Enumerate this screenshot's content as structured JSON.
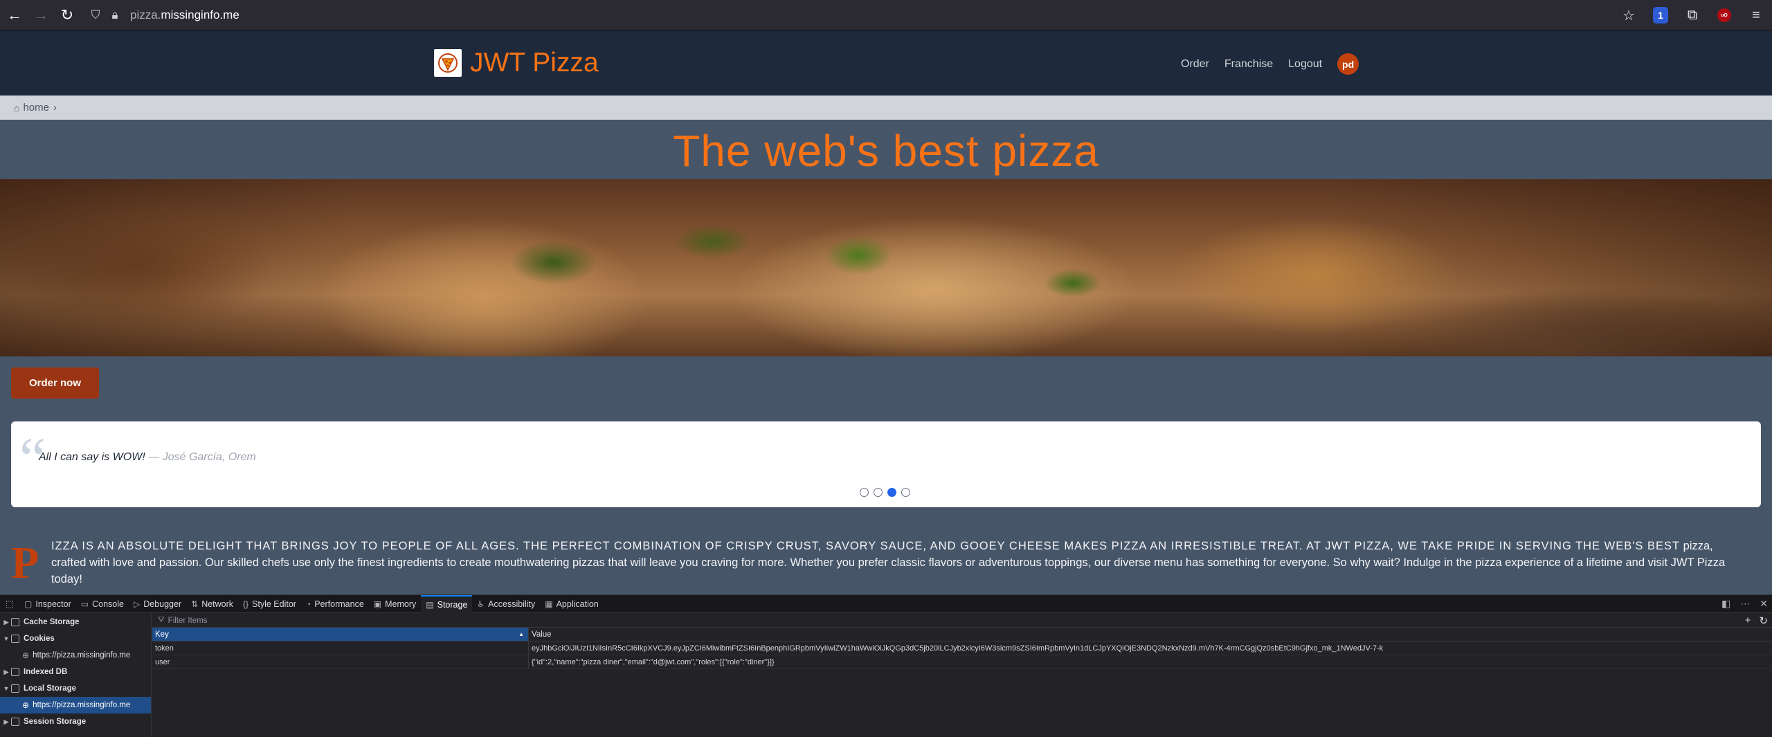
{
  "browser": {
    "url_host": "pizza.",
    "url_domain": "missinginfo.me",
    "shield_badge": "1",
    "ub_label": "uO"
  },
  "site": {
    "brand": "JWT Pizza",
    "nav": [
      "Order",
      "Franchise",
      "Logout"
    ],
    "avatar": "pd",
    "breadcrumb": "home",
    "hero_title": "The web's best pizza",
    "order_button": "Order now",
    "testimonial": {
      "quote": "All I can say is WOW!",
      "author": "— José García, Orem",
      "dots": 4,
      "active_dot": 2
    },
    "drop_cap": "P",
    "paragraph_caps": "izza is an absolute delight that brings joy to people of all ages. The perfect combination of crispy crust, savory sauce, and gooey cheese makes pizza an irresistible treat. At JWT Pizza, we take pride in serving the web's best",
    "paragraph_rest": " pizza, crafted with love and passion. Our skilled chefs use only the finest ingredients to create mouthwatering pizzas that will leave you craving for more. Whether you prefer classic flavors or adventurous toppings, our diverse menu has something for everyone. So why wait? Indulge in the pizza experience of a lifetime and visit JWT Pizza today!"
  },
  "devtools": {
    "tabs": [
      {
        "label": "Inspector",
        "icon": "inspector-icon"
      },
      {
        "label": "Console",
        "icon": "console-icon"
      },
      {
        "label": "Debugger",
        "icon": "debugger-icon"
      },
      {
        "label": "Network",
        "icon": "network-icon"
      },
      {
        "label": "Style Editor",
        "icon": "style-editor-icon"
      },
      {
        "label": "Performance",
        "icon": "performance-icon"
      },
      {
        "label": "Memory",
        "icon": "memory-icon"
      },
      {
        "label": "Storage",
        "icon": "storage-icon"
      },
      {
        "label": "Accessibility",
        "icon": "accessibility-icon"
      },
      {
        "label": "Application",
        "icon": "application-icon"
      }
    ],
    "active_tab": "Storage",
    "tree": {
      "cache_storage": "Cache Storage",
      "cookies": "Cookies",
      "cookies_child": "https://pizza.missinginfo.me",
      "indexed_db": "Indexed DB",
      "local_storage": "Local Storage",
      "local_storage_child": "https://pizza.missinginfo.me",
      "session_storage": "Session Storage"
    },
    "filter_placeholder": "Filter Items",
    "columns": {
      "key": "Key",
      "value": "Value"
    },
    "rows": [
      {
        "key": "token",
        "value": "eyJhbGciOiJIUzI1NiIsInR5cCI6IkpXVCJ9.eyJpZCI6MiwibmFtZSI6InBpenphIGRpbmVyIiwiZW1haWwiOiJkQGp3dC5jb20iLCJyb2xlcyI6W3sicm9sZSI6ImRpbmVyIn1dLCJpYXQiOjE3NDQ2NzkxNzd9.mVh7K-4rmCGgjQz0sbEtC9hGjfxo_mk_1NWedJV-7-k"
      },
      {
        "key": "user",
        "value": "{\"id\":2,\"name\":\"pizza diner\",\"email\":\"d@jwt.com\",\"roles\":[{\"role\":\"diner\"}]}"
      }
    ]
  },
  "colors": {
    "accent": "#f97316",
    "header_bg": "#1e293b",
    "page_bg": "#475569",
    "button_bg": "#9a3412",
    "devtools_selected": "#204e8a"
  }
}
